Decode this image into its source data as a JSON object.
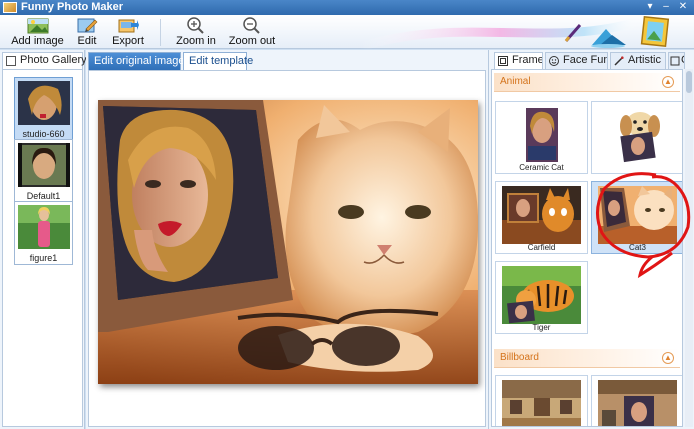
{
  "window": {
    "title": "Funny Photo Maker",
    "controls": [
      "▾",
      "–",
      "✕"
    ]
  },
  "toolbar": {
    "add_image": "Add image",
    "edit": "Edit",
    "export": "Export",
    "zoom_in": "Zoom in",
    "zoom_out": "Zoom out"
  },
  "left_panel": {
    "tab": "Photo Gallery",
    "items": [
      {
        "caption": "studio-660",
        "selected": true
      },
      {
        "caption": "Default1",
        "selected": false
      },
      {
        "caption": "figure1",
        "selected": false
      }
    ]
  },
  "center": {
    "tabs": [
      {
        "label": "Edit original image",
        "active": true
      },
      {
        "label": "Edit template",
        "active": false
      }
    ]
  },
  "right_panel": {
    "tabs": [
      {
        "label": "Frame",
        "icon": "frame-icon",
        "active": true
      },
      {
        "label": "Face Fun",
        "icon": "smiley-icon",
        "active": false
      },
      {
        "label": "Artistic",
        "icon": "brush-icon",
        "active": false
      },
      {
        "label": "C",
        "icon": "clipart-icon",
        "active": false
      }
    ],
    "sections": [
      {
        "title": "Animal",
        "tiles": [
          {
            "caption": "Ceramic Cat",
            "selected": false
          },
          {
            "caption": "",
            "selected": false
          },
          {
            "caption": "Carfield",
            "selected": false
          },
          {
            "caption": "Cat3",
            "selected": true
          },
          {
            "caption": "Tiger",
            "selected": false
          }
        ]
      },
      {
        "title": "Billboard",
        "tiles": [
          {
            "caption": ""
          },
          {
            "caption": ""
          }
        ]
      }
    ]
  },
  "colors": {
    "accent": "#2f6fb8",
    "section_title": "#d4731b",
    "annotation": "#e01515"
  }
}
